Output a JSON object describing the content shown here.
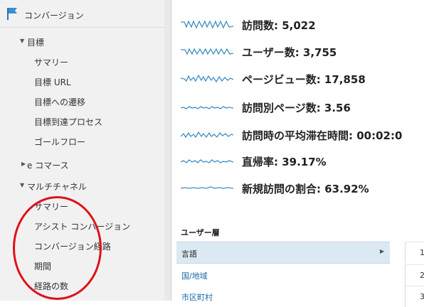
{
  "sidebar": {
    "conversion": {
      "label": "コンバージョン"
    },
    "goals": {
      "header": "目標",
      "items": [
        "サマリー",
        "目標 URL",
        "目標への遷移",
        "目標到達プロセス",
        "ゴールフロー"
      ]
    },
    "ecommerce": {
      "header": "e コマース"
    },
    "multichannel": {
      "header": "マルチチャネル",
      "items": [
        "サマリー",
        "アシスト コンバージョン",
        "コンバージョン経路",
        "期間",
        "経路の数"
      ]
    }
  },
  "metrics": [
    {
      "label": "訪問数: 5,022"
    },
    {
      "label": "ユーザー数: 3,755"
    },
    {
      "label": "ページビュー数: 17,858"
    },
    {
      "label": "訪問別ページ数: 3.56"
    },
    {
      "label": "訪問時の平均滞在時間: 00:02:0"
    },
    {
      "label": "直帰率: 39.17%"
    },
    {
      "label": "新規訪問の割合: 63.92%"
    }
  ],
  "segments": {
    "title": "ユーザー層",
    "rows": [
      {
        "label": "言語",
        "value": "1"
      },
      {
        "label": "国/地域",
        "value": "2"
      },
      {
        "label": "市区町村",
        "value": "3"
      }
    ]
  },
  "colors": {
    "accent": "#3f8fc2",
    "sparkline": "#3f8fc2",
    "highlight_ellipse": "#e0111a",
    "selected_row": "#dbe9f3"
  }
}
